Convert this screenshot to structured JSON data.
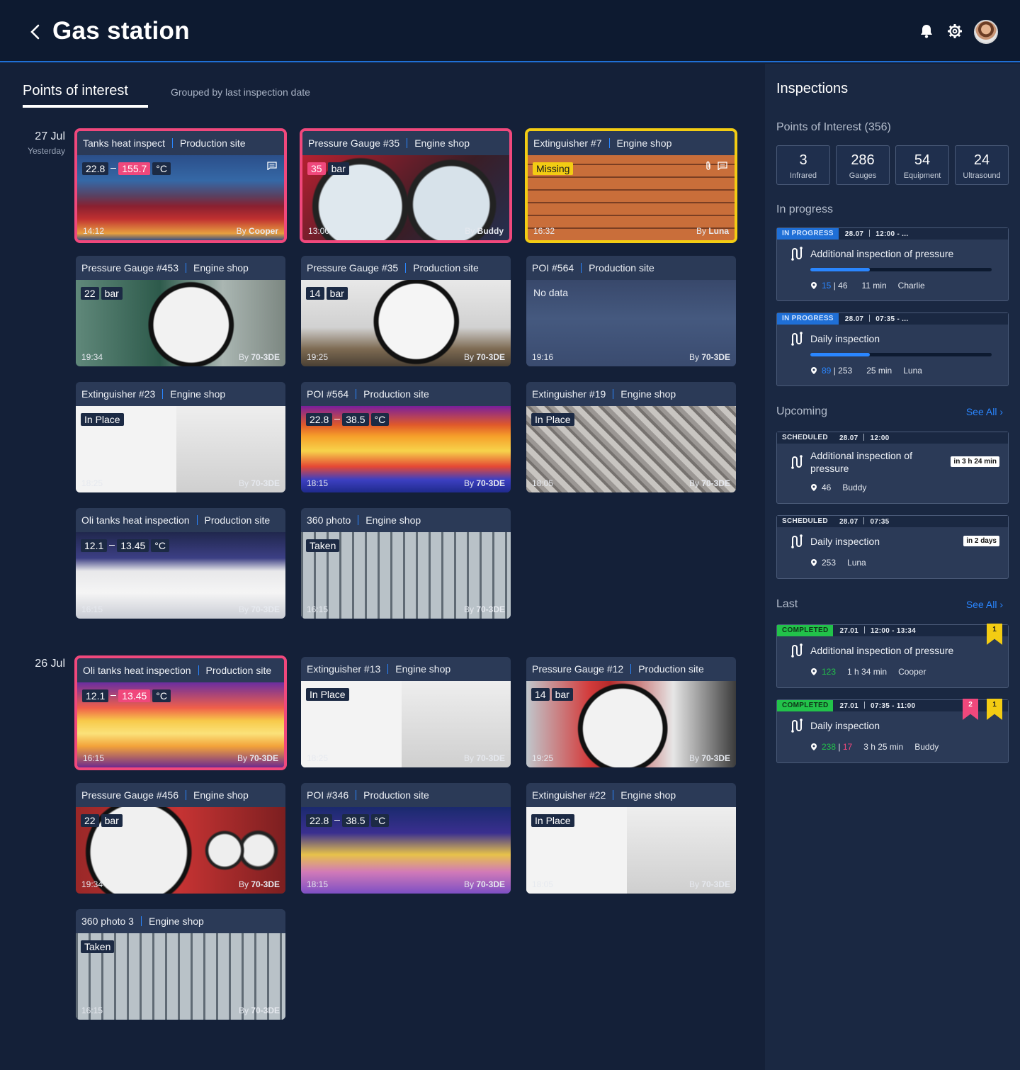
{
  "header": {
    "title": "Gas station",
    "icons": [
      "back-arrow-icon",
      "bell-icon",
      "gear-icon",
      "avatar"
    ]
  },
  "left": {
    "tab": "Points of interest",
    "subtitle": "Grouped by last inspection date",
    "groups": [
      {
        "date": "27 Jul",
        "sub": "Yesterday",
        "cards": [
          {
            "title": "Tanks heat inspect",
            "loc": "Production site",
            "v1": "22.8",
            "v2": "155.7",
            "unit": "°C",
            "time": "14:12",
            "by": "Cooper"
          },
          {
            "title": "Pressure Gauge #35",
            "loc": "Engine shop",
            "v1": "35",
            "unit": "bar",
            "time": "13:00",
            "by": "Buddy"
          },
          {
            "title": "Extinguisher #7",
            "loc": "Engine shop",
            "status": "Missing",
            "time": "16:32",
            "by": "Luna"
          },
          {
            "title": "Pressure Gauge #453",
            "loc": "Engine shop",
            "v1": "22",
            "unit": "bar",
            "time": "19:34",
            "by": "70-3DE"
          },
          {
            "title": "Pressure Gauge #35",
            "loc": "Production site",
            "v1": "14",
            "unit": "bar",
            "time": "19:25",
            "by": "70-3DE"
          },
          {
            "title": "POI #564",
            "loc": "Production site",
            "status": "No data",
            "time": "19:16",
            "by": "70-3DE"
          },
          {
            "title": "Extinguisher #23",
            "loc": "Engine shop",
            "status": "In Place",
            "time": "18:25",
            "by": "70-3DE"
          },
          {
            "title": "POI #564",
            "loc": "Production site",
            "v1": "22.8",
            "v2": "38.5",
            "unit": "°C",
            "time": "18:15",
            "by": "70-3DE"
          },
          {
            "title": "Extinguisher #19",
            "loc": "Engine shop",
            "status": "In Place",
            "time": "18:05",
            "by": "70-3DE"
          },
          {
            "title": "Oli tanks heat inspection",
            "loc": "Production site",
            "v1": "12.1",
            "v2": "13.45",
            "unit": "°C",
            "time": "16:15",
            "by": "70-3DE"
          },
          {
            "title": "360 photo",
            "loc": "Engine shop",
            "status": "Taken",
            "time": "16:15",
            "by": "70-3DE"
          }
        ]
      },
      {
        "date": "26 Jul",
        "sub": "",
        "cards": [
          {
            "title": "Oli tanks heat inspection",
            "loc": "Production site",
            "v1": "12.1",
            "v2": "13.45",
            "unit": "°C",
            "time": "16:15",
            "by": "70-3DE"
          },
          {
            "title": "Extinguisher #13",
            "loc": "Engine shop",
            "status": "In Place",
            "time": "18:25",
            "by": "70-3DE"
          },
          {
            "title": "Pressure Gauge #12",
            "loc": "Production site",
            "v1": "14",
            "unit": "bar",
            "time": "19:25",
            "by": "70-3DE"
          },
          {
            "title": "Pressure Gauge #456",
            "loc": "Engine shop",
            "v1": "22",
            "unit": "bar",
            "time": "19:34",
            "by": "70-3DE"
          },
          {
            "title": "POI #346",
            "loc": "Production site",
            "v1": "22.8",
            "v2": "38.5",
            "unit": "°C",
            "time": "18:15",
            "by": "70-3DE"
          },
          {
            "title": "Extinguisher #22",
            "loc": "Engine shop",
            "status": "In Place",
            "time": "18:05",
            "by": "70-3DE"
          },
          {
            "title": "360 photo 3",
            "loc": "Engine shop",
            "status": "Taken",
            "time": "16:15",
            "by": "70-3DE"
          }
        ]
      }
    ],
    "by_prefix": "By"
  },
  "right": {
    "title": "Inspections",
    "poi_heading": "Points of Interest (356)",
    "stats": [
      {
        "n": "3",
        "l": "Infrared"
      },
      {
        "n": "286",
        "l": "Gauges"
      },
      {
        "n": "54",
        "l": "Equipment"
      },
      {
        "n": "24",
        "l": "Ultrasound"
      }
    ],
    "in_progress_heading": "In progress",
    "in_progress": [
      {
        "status": "IN PROGRESS",
        "date": "28.07",
        "time": "12:00 - ...",
        "name": "Additional inspection of pressure",
        "progress": 0.33,
        "done": "15",
        "total": "46",
        "dur": "11 min",
        "user": "Charlie"
      },
      {
        "status": "IN PROGRESS",
        "date": "28.07",
        "time": "07:35 - ...",
        "name": "Daily inspection",
        "progress": 0.33,
        "done": "89",
        "total": "253",
        "dur": "25 min",
        "user": "Luna"
      }
    ],
    "upcoming_heading": "Upcoming",
    "see_all": "See All",
    "upcoming": [
      {
        "status": "SCHEDULED",
        "date": "28.07",
        "time": "12:00",
        "name1": "Additional inspection of",
        "name2": "pressure",
        "count": "46",
        "user": "Buddy",
        "badge": "in 3 h 24 min"
      },
      {
        "status": "SCHEDULED",
        "date": "28.07",
        "time": "07:35",
        "name1": "Daily inspection",
        "count": "253",
        "user": "Luna",
        "badge": "in 2 days"
      }
    ],
    "last_heading": "Last",
    "last": [
      {
        "status": "COMPLETED",
        "date": "27.01",
        "time": "12:00 - 13:34",
        "name": "Additional inspection of pressure",
        "count": "123",
        "dur": "1 h 34 min",
        "user": "Cooper",
        "flag_y": "1"
      },
      {
        "status": "COMPLETED",
        "date": "27.01",
        "time": "07:35 - 11:00",
        "name": "Daily inspection",
        "count": "238",
        "missed": "17",
        "dur": "3 h 25 min",
        "user": "Buddy",
        "flag_p": "2",
        "flag_y": "1"
      }
    ]
  }
}
